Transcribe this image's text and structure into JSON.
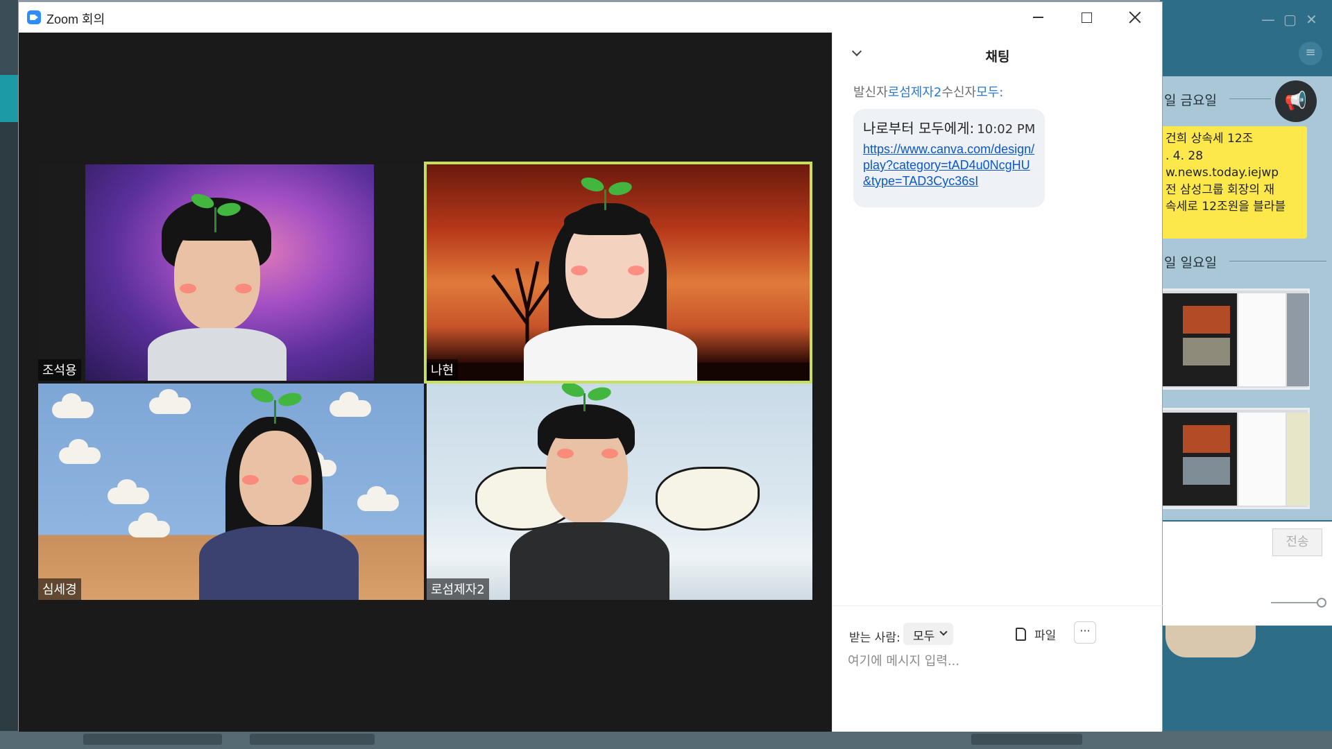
{
  "window": {
    "title": "Zoom 회의"
  },
  "participants": [
    {
      "name": "조석용",
      "active": false
    },
    {
      "name": "나현",
      "active": true
    },
    {
      "name": "심세경",
      "active": false
    },
    {
      "name": "로섬제자2",
      "active": false
    }
  ],
  "chat": {
    "heading": "채팅",
    "sender_prefix": "발신자",
    "sender_name": "로섬제자2",
    "recipient_prefix": "수신자",
    "recipient_name": "모두",
    "recipient_suffix": ":",
    "message": {
      "header": "나로부터 모두에게:",
      "time": "10:02 PM",
      "link": "https://www.canva.com/design/play?category=tAD4u0NcgHU&type=TAD3Cyc36sI"
    },
    "to_label": "받는 사람:",
    "to_value": "모두",
    "file_label": "파일",
    "more_label": "···",
    "input_placeholder": "여기에 메시지 입력..."
  },
  "side_app": {
    "date1": "일 금요일",
    "date2": "일 일요일",
    "yellow_lines": [
      "건희 상속세 12조",
      ". 4. 28",
      "w.news.today.iejwp",
      "전 삼성그룹 회장의 재",
      "속세로 12조원을 블라블"
    ],
    "send_label": "전송"
  },
  "colors": {
    "accent_blue": "#2d79d6",
    "link": "#0b57d0",
    "active_speaker": "#c8df5a",
    "zoom_brand": "#2d8cff"
  },
  "icons": [
    "zoom-logo-icon",
    "minimize-icon",
    "maximize-icon",
    "close-icon",
    "chevron-down-icon",
    "file-icon",
    "more-icon",
    "megaphone-icon",
    "menu-icon"
  ]
}
